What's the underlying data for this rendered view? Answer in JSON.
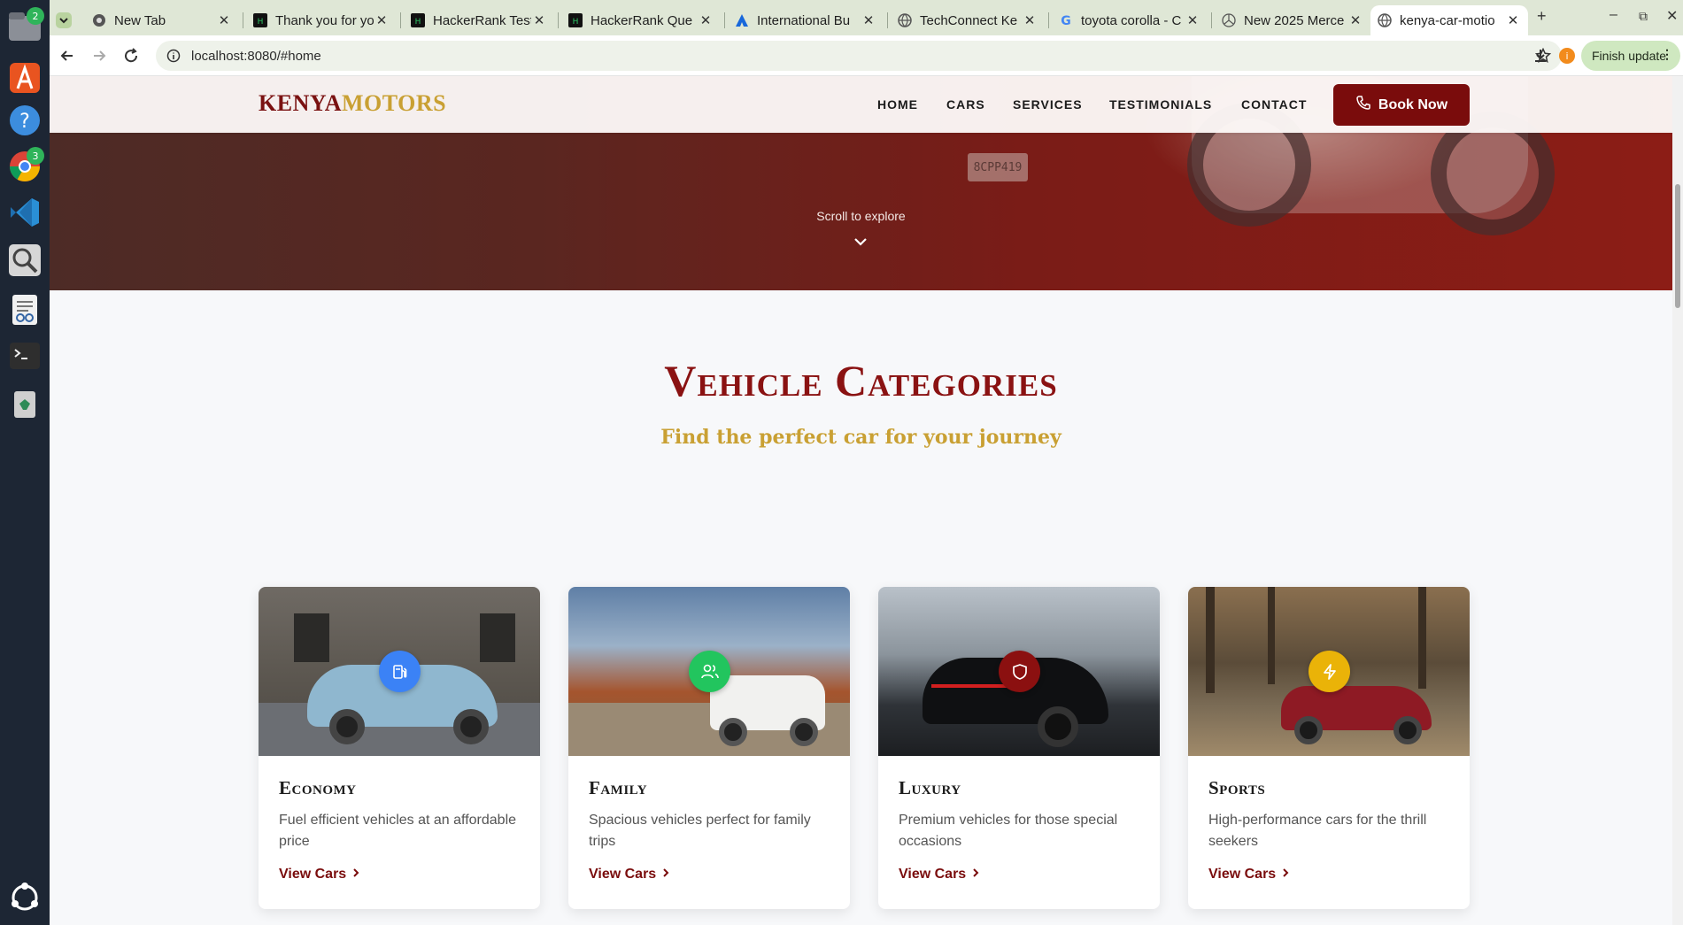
{
  "dock": {
    "files_badge": "2",
    "chrome_badge": "3"
  },
  "browser": {
    "tabs": [
      {
        "title": "New Tab"
      },
      {
        "title": "Thank you for yo"
      },
      {
        "title": "HackerRank Test"
      },
      {
        "title": "HackerRank Que"
      },
      {
        "title": "International Bu"
      },
      {
        "title": "TechConnect Ke"
      },
      {
        "title": "toyota corolla - C"
      },
      {
        "title": "New 2025 Merce"
      },
      {
        "title": "kenya-car-motio"
      }
    ],
    "url": "localhost:8080/#home",
    "update_label": "Finish update"
  },
  "site": {
    "logo_part1": "KENYA",
    "logo_part2": "MOTORS",
    "nav": [
      "HOME",
      "CARS",
      "SERVICES",
      "TESTIMONIALS",
      "CONTACT"
    ],
    "book_label": "Book Now",
    "hero_plate": "8CPP419",
    "scroll_hint": "Scroll to explore"
  },
  "categories": {
    "title": "Vehicle Categories",
    "subtitle": "Find the perfect car for your journey",
    "link_label": "View Cars",
    "items": [
      {
        "name": "Economy",
        "desc": "Fuel efficient vehicles at an affordable price",
        "icon": "fuel-icon",
        "icon_color": "#3b82f6"
      },
      {
        "name": "Family",
        "desc": "Spacious vehicles perfect for family trips",
        "icon": "users-icon",
        "icon_color": "#22c55e"
      },
      {
        "name": "Luxury",
        "desc": "Premium vehicles for those special occasions",
        "icon": "shield-icon",
        "icon_color": "#8b1010"
      },
      {
        "name": "Sports",
        "desc": "High-performance cars for the thrill seekers",
        "icon": "bolt-icon",
        "icon_color": "#eab308"
      }
    ]
  },
  "colors": {
    "brand_red": "#7a0c0c",
    "brand_gold": "#c9a033"
  }
}
